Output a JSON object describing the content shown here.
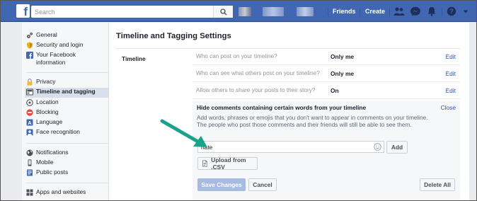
{
  "topbar": {
    "logo": "f",
    "search_placeholder": "Search",
    "friends_label": "Friends",
    "create_label": "Create",
    "colors": {
      "bar": "#4267b2",
      "text": "#ffffff"
    },
    "icons": [
      "search-icon",
      "friend-requests-icon",
      "messenger-icon",
      "notifications-icon",
      "help-icon",
      "account-menu-icon"
    ]
  },
  "sidebar": {
    "groups": [
      [
        {
          "label": "General",
          "icon": "gear-icon"
        },
        {
          "label": "Security and login",
          "icon": "shield-icon"
        },
        {
          "label": "Your Facebook information",
          "icon": "facebook-icon"
        }
      ],
      [
        {
          "label": "Privacy",
          "icon": "lock-icon"
        },
        {
          "label": "Timeline and tagging",
          "icon": "timeline-icon",
          "active": true
        },
        {
          "label": "Location",
          "icon": "location-icon"
        },
        {
          "label": "Blocking",
          "icon": "blocking-icon"
        },
        {
          "label": "Language",
          "icon": "language-icon"
        },
        {
          "label": "Face recognition",
          "icon": "face-recognition-icon"
        }
      ],
      [
        {
          "label": "Notifications",
          "icon": "globe-icon"
        },
        {
          "label": "Mobile",
          "icon": "mobile-icon"
        },
        {
          "label": "Public posts",
          "icon": "public-posts-icon"
        }
      ],
      [
        {
          "label": "Apps and websites",
          "icon": "apps-icon"
        }
      ]
    ]
  },
  "main": {
    "title": "Timeline and Tagging Settings",
    "section_label": "Timeline",
    "rows": [
      {
        "question": "Who can post on your timeline?",
        "value": "Only me",
        "action": "Edit"
      },
      {
        "question": "Who can see what others post on your timeline?",
        "value": "Only me",
        "action": "Edit"
      },
      {
        "question": "Allow others to share your posts to their story?",
        "value": "On",
        "action": "Edit"
      }
    ],
    "hide_comments": {
      "title": "Hide comments containing certain words from your timeline",
      "close_label": "Close",
      "description": "Add words, phrases or emojis that you don't want to appear in comments on your timeline. The people who post those comments and their friends will still be able to see them.",
      "input_value": "hate",
      "add_label": "Add",
      "upload_label": "Upload from .CSV",
      "save_label": "Save Changes",
      "cancel_label": "Cancel",
      "delete_all_label": "Delete All"
    }
  },
  "annotation": {
    "arrow_color": "#1aa38b"
  }
}
